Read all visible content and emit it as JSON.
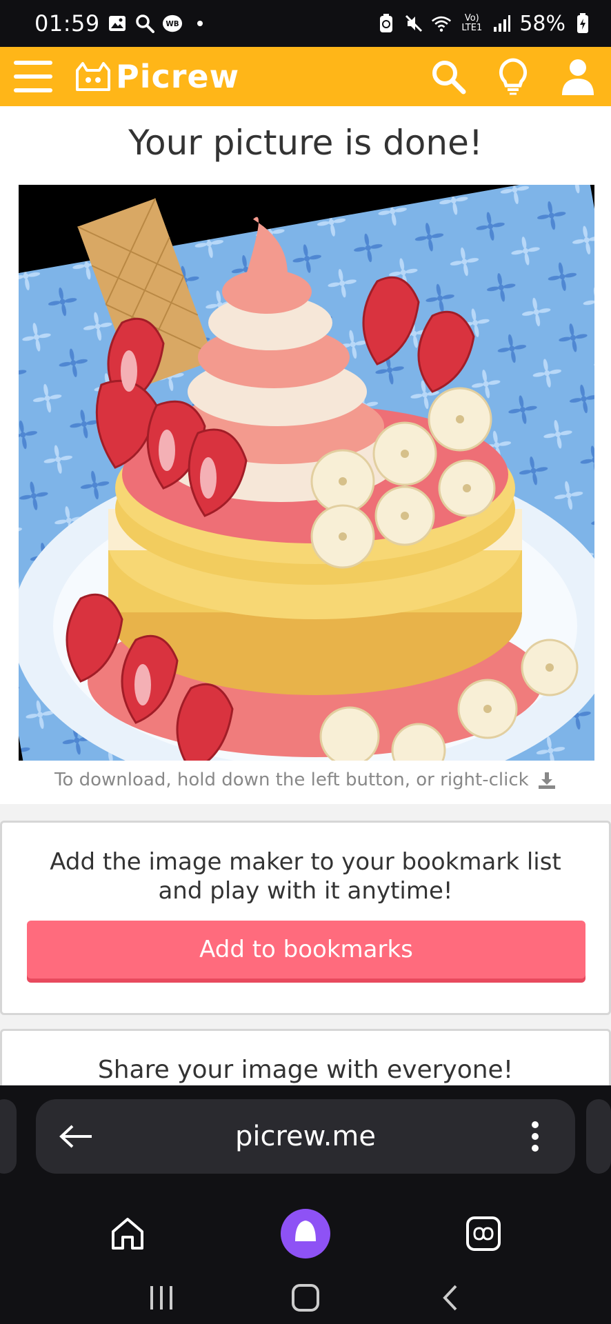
{
  "status_bar": {
    "time": "01:59",
    "battery": "58%",
    "network_label": "Vo) LTE1",
    "left_icons": [
      "gallery-icon",
      "search-icon",
      "wb-badge-icon",
      "dot-icon"
    ],
    "right_icons": [
      "battery-saver-icon",
      "mute-icon",
      "wifi-icon",
      "lte-icon",
      "signal-icon",
      "battery-icon"
    ],
    "wb_badge": "WB"
  },
  "header": {
    "logo_text": "Picrew",
    "menu_icon": "hamburger-icon",
    "actions": [
      "search-icon",
      "lightbulb-icon",
      "user-icon"
    ],
    "accent_color": "#ffb618"
  },
  "main": {
    "title": "Your picture is done!",
    "image_alt": "strawberry banana layer cake with soft serve",
    "download_hint": "To download, hold down the left button, or right-click"
  },
  "bookmark_card": {
    "text_line1": "Add the image maker to your bookmark list",
    "text_line2": "and play with it anytime!",
    "button_label": "Add to bookmarks",
    "button_color": "#ff6b7d"
  },
  "share_card": {
    "text": "Share your image with everyone!"
  },
  "browser": {
    "url": "picrew.me",
    "bottom_icons": [
      "home-icon",
      "assistant-icon",
      "tabs-icon"
    ]
  }
}
